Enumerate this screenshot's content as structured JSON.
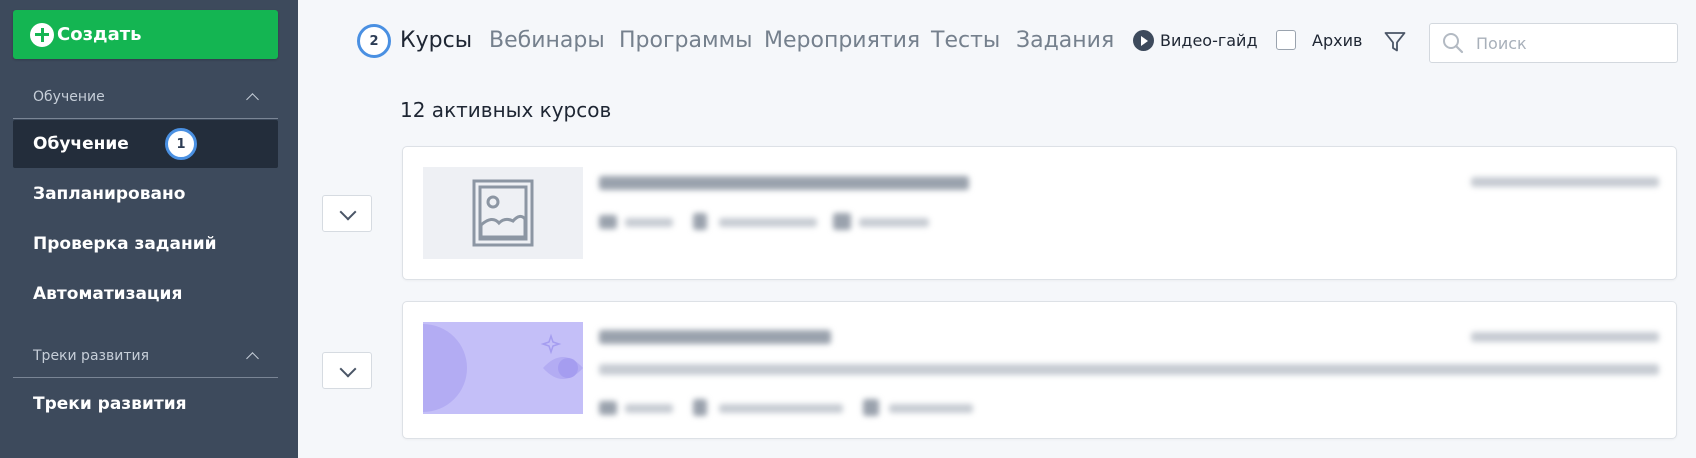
{
  "sidebar": {
    "create_label": "Создать",
    "section1_title": "Обучение",
    "items": [
      {
        "label": "Обучение"
      },
      {
        "label": "Запланировано"
      },
      {
        "label": "Проверка заданий"
      },
      {
        "label": "Автоматизация"
      }
    ],
    "section2_title": "Треки развития",
    "items2": [
      {
        "label": "Треки развития"
      }
    ],
    "active_badge": "1"
  },
  "tabs": {
    "step_badge": "2",
    "items": [
      {
        "label": "Курсы"
      },
      {
        "label": "Вебинары"
      },
      {
        "label": "Программы"
      },
      {
        "label": "Мероприятия"
      },
      {
        "label": "Тесты"
      },
      {
        "label": "Задания"
      }
    ]
  },
  "toolbar": {
    "video_guide": "Видео-гайд",
    "archive_label": "Архив",
    "search_placeholder": "Поиск"
  },
  "main": {
    "count_title": "12 активных курсов"
  },
  "colors": {
    "sidebar_bg": "#3d4a5c",
    "create_green": "#14b552",
    "accent_blue": "#4a90e2"
  }
}
